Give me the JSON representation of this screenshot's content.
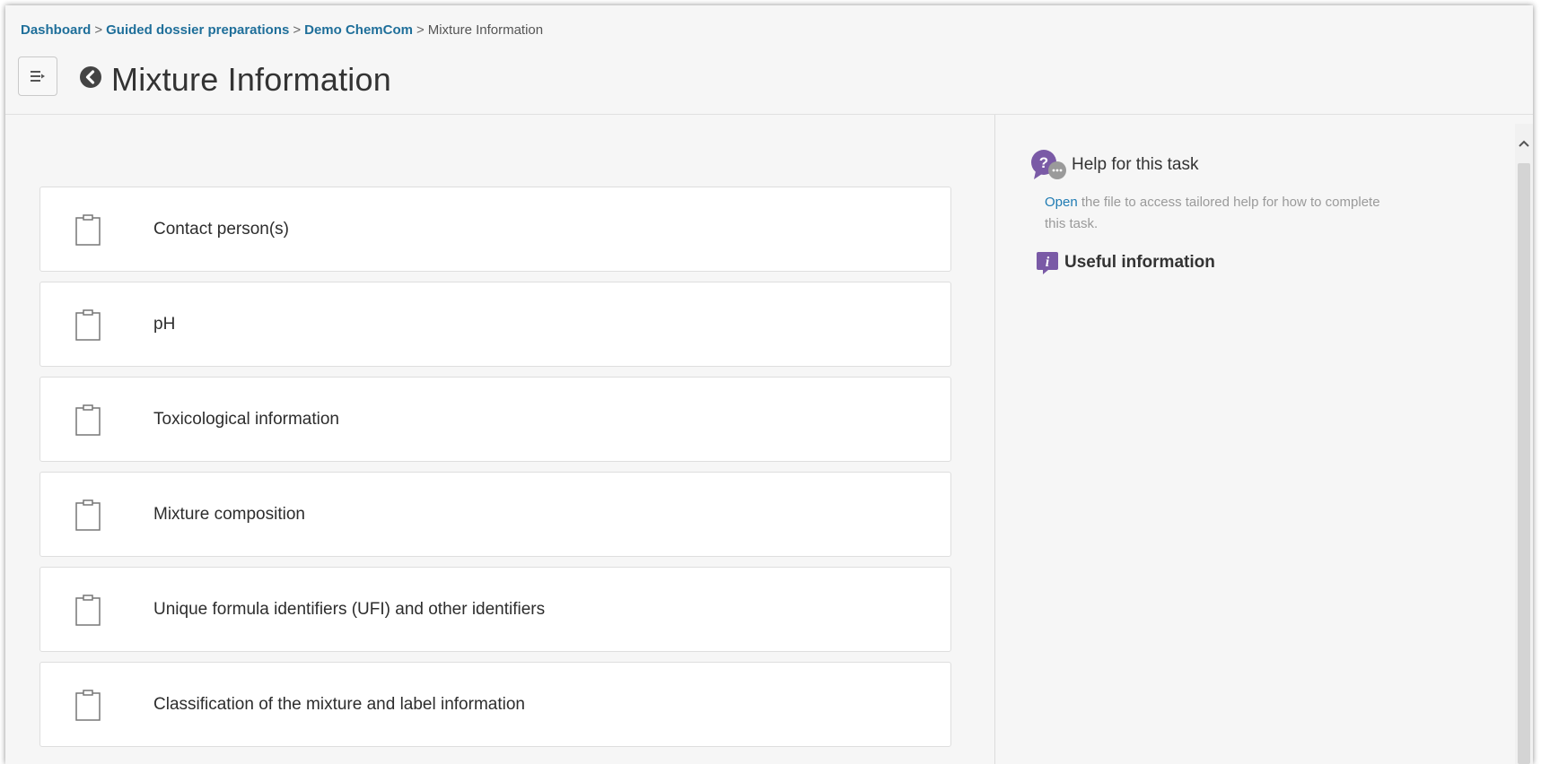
{
  "breadcrumb": {
    "items": [
      "Dashboard",
      "Guided dossier preparations",
      "Demo ChemCom"
    ],
    "current": "Mixture Information",
    "separator": ">"
  },
  "header": {
    "title": "Mixture Information",
    "icons": {
      "menu": "menu-toggle-icon",
      "back": "back-arrow-icon"
    }
  },
  "tasks": [
    {
      "label": "Contact person(s)",
      "icon": "clipboard-icon"
    },
    {
      "label": "pH",
      "icon": "clipboard-icon"
    },
    {
      "label": "Toxicological information",
      "icon": "clipboard-icon"
    },
    {
      "label": "Mixture composition",
      "icon": "clipboard-icon"
    },
    {
      "label": "Unique formula identifiers (UFI) and other identifiers",
      "icon": "clipboard-icon"
    },
    {
      "label": "Classification of the mixture and label information",
      "icon": "clipboard-icon"
    }
  ],
  "help": {
    "title": "Help for this task",
    "link_text": "Open",
    "text": " the file to access tailored help for how to complete this task.",
    "icon": "help-chat-icon"
  },
  "useful": {
    "title": "Useful information",
    "icon": "info-icon"
  },
  "colors": {
    "link": "#1f6f9a",
    "accent_purple": "#7a5aa6",
    "background": "#f6f6f6",
    "card": "#ffffff"
  }
}
